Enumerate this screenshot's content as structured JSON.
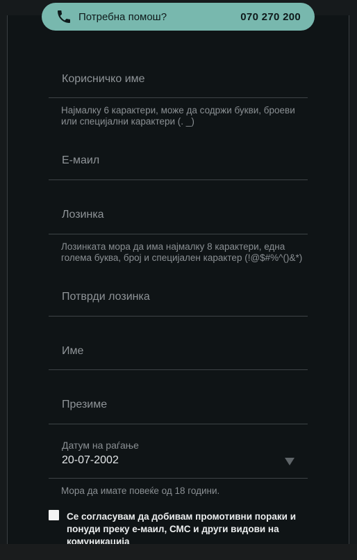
{
  "help": {
    "text": "Потребна помош?",
    "phone": "070 270 200",
    "icon": "phone-icon"
  },
  "form": {
    "username_placeholder": "Корисничко име",
    "username_hint": "Најмалку 6 карактери, може да содржи букви, броеви или специјални карактери (. _)",
    "email_placeholder": "Е-маил",
    "password_placeholder": "Лозинка",
    "password_hint": "Лозинката мора да има најмалку 8 карактери, една голема буква, број и специјален карактер (!@$#%^()&*)",
    "confirm_password_placeholder": "Потврди лозинка",
    "first_name_placeholder": "Име",
    "last_name_placeholder": "Презиме",
    "birthdate_label": "Датум на раѓање",
    "birthdate_value": "20-07-2002",
    "birthdate_hint": "Мора да имате повеќе од 18 години.",
    "consent_label": "Се согласувам да добивам промотивни пораки и понуди преку е-маил, СМС и други видови на комуникација",
    "consent_checked": false
  },
  "colors": {
    "accent": "#78b8ae",
    "background": "#0f1416"
  }
}
